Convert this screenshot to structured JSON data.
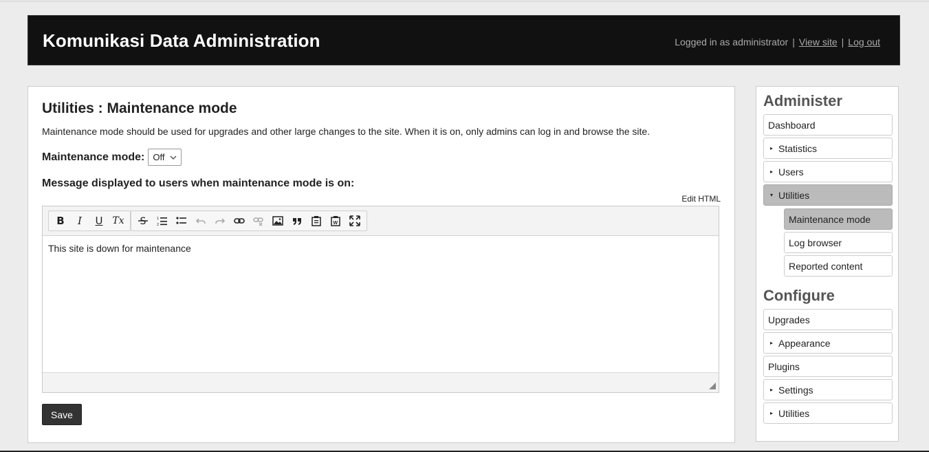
{
  "header": {
    "title": "Komunikasi Data Administration",
    "logged_in_text": "Logged in as administrator",
    "separator": "|",
    "view_site": "View site",
    "log_out": "Log out"
  },
  "main": {
    "title": "Utilities : Maintenance mode",
    "description": "Maintenance mode should be used for upgrades and other large changes to the site. When it is on, only admins can log in and browse the site.",
    "mode_label": "Maintenance mode:",
    "mode_value": "Off",
    "message_label": "Message displayed to users when maintenance mode is on:",
    "edit_html": "Edit HTML",
    "editor_content": "This site is down for maintenance",
    "toolbar": {
      "bold": "B",
      "italic": "I",
      "underline": "U",
      "clear_format": "Tx"
    },
    "save_label": "Save"
  },
  "sidebar": {
    "administer_heading": "Administer",
    "administer_items": [
      {
        "label": "Dashboard"
      },
      {
        "label": "Statistics",
        "marker": "▸"
      },
      {
        "label": "Users",
        "marker": "▸"
      },
      {
        "label": "Utilities",
        "marker": "▾"
      }
    ],
    "utilities_subitems": [
      {
        "label": "Maintenance mode"
      },
      {
        "label": "Log browser"
      },
      {
        "label": "Reported content"
      }
    ],
    "configure_heading": "Configure",
    "configure_items": [
      {
        "label": "Upgrades"
      },
      {
        "label": "Appearance",
        "marker": "▸"
      },
      {
        "label": "Plugins"
      },
      {
        "label": "Settings",
        "marker": "▸"
      },
      {
        "label": "Utilities",
        "marker": "▸"
      }
    ]
  }
}
